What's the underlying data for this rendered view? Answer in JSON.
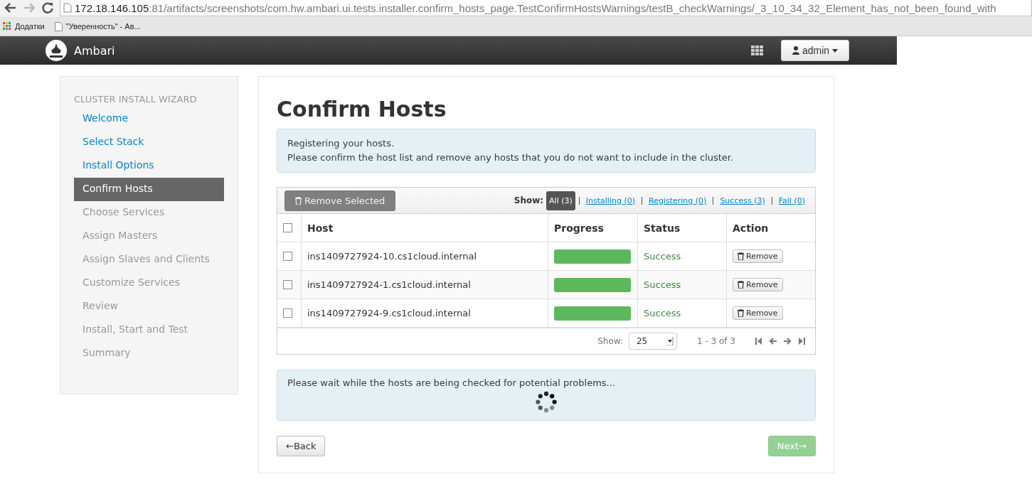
{
  "browser": {
    "url_host": "172.18.146.105",
    "url_rest": ":81/artifacts/screenshots/com.hw.ambari.ui.tests.installer.confirm_hosts_page.TestConfirmHostsWarnings/testB_checkWarnings/_3_10_34_32_Element_has_not_been_found_with",
    "bookmarks": [
      {
        "kind": "apps",
        "label": "Додатки"
      },
      {
        "kind": "page",
        "label": "\"Уверенность\" - Ав..."
      }
    ]
  },
  "navbar": {
    "brand": "Ambari",
    "user": "admin"
  },
  "sidebar": {
    "title": "CLUSTER INSTALL WIZARD",
    "items": [
      {
        "label": "Welcome",
        "selected": false,
        "disabled": false
      },
      {
        "label": "Select Stack",
        "selected": false,
        "disabled": false
      },
      {
        "label": "Install Options",
        "selected": false,
        "disabled": false
      },
      {
        "label": "Confirm Hosts",
        "selected": true,
        "disabled": false
      },
      {
        "label": "Choose Services",
        "selected": false,
        "disabled": true
      },
      {
        "label": "Assign Masters",
        "selected": false,
        "disabled": true
      },
      {
        "label": "Assign Slaves and Clients",
        "selected": false,
        "disabled": true
      },
      {
        "label": "Customize Services",
        "selected": false,
        "disabled": true
      },
      {
        "label": "Review",
        "selected": false,
        "disabled": true
      },
      {
        "label": "Install, Start and Test",
        "selected": false,
        "disabled": true
      },
      {
        "label": "Summary",
        "selected": false,
        "disabled": true
      }
    ]
  },
  "main": {
    "title": "Confirm Hosts",
    "info": [
      "Registering your hosts.",
      "Please confirm the host list and remove any hosts that you do not want to include in the cluster."
    ],
    "remove_selected": "Remove Selected",
    "show_label": "Show:",
    "filters": [
      {
        "label": "All (3)",
        "selected": true
      },
      {
        "label": "Installing (0)",
        "selected": false
      },
      {
        "label": "Registering (0)",
        "selected": false
      },
      {
        "label": "Success (3)",
        "selected": false
      },
      {
        "label": "Fail (0)",
        "selected": false
      }
    ],
    "table": {
      "select_all_checked": false,
      "columns": [
        "Host",
        "Progress",
        "Status",
        "Action"
      ],
      "rows": [
        {
          "checked": false,
          "host": "ins1409727924-10.cs1cloud.internal",
          "level": 1,
          "status": "Success",
          "action": "Remove"
        },
        {
          "checked": false,
          "host": "ins1409727924-1.cs1cloud.internal",
          "level": 1,
          "status": "Success",
          "action": "Remove"
        },
        {
          "checked": false,
          "host": "ins1409727924-9.cs1cloud.internal",
          "level": 1,
          "status": "Success",
          "action": "Remove"
        }
      ]
    },
    "pager": {
      "show_label": "Show:",
      "page_size": "25",
      "range": "1 - 3 of 3"
    },
    "wait_message": "Please wait while the hosts are being checked for potential problems...",
    "back": "←Back",
    "next": "Next→",
    "next_disabled": true
  }
}
